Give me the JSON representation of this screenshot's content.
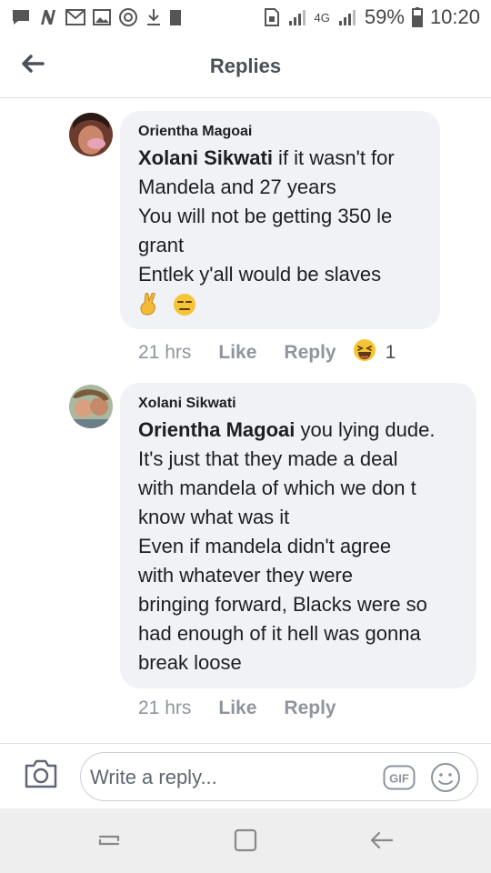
{
  "status_bar": {
    "left_icons": [
      "messenger-icon",
      "n-icon",
      "gmail-icon",
      "gallery-icon",
      "instagram-icon",
      "download-icon",
      "storage-icon"
    ],
    "network_label": "4G",
    "battery_percent": "59%",
    "time": "10:20"
  },
  "header": {
    "title": "Replies"
  },
  "comments": [
    {
      "author": "Orientha Magoai",
      "mention": "Xolani Sikwati",
      "first_line_rest": " if it wasn't for",
      "lines": [
        "Mandela and 27 years",
        "You will not be  getting 350 le",
        "grant",
        "Entlek y'all would be slaves"
      ],
      "emojis": [
        "crossed-fingers-emoji",
        "unamused-face-emoji"
      ],
      "time": "21 hrs",
      "like_label": "Like",
      "reply_label": "Reply",
      "reaction_icon": "haha-reaction-icon",
      "reaction_count": "1"
    },
    {
      "author": "Xolani Sikwati",
      "mention": "Orientha Magoai",
      "first_line_rest": " you lying  dude.",
      "lines": [
        "It's  just that they made a deal",
        "with mandela of which we don t",
        "know what was it",
        "Even if mandela didn't  agree",
        "with  whatever  they were",
        "bringing forward, Blacks were so",
        "had enough  of it hell was gonna",
        "break loose"
      ],
      "time": "21 hrs",
      "like_label": "Like",
      "reply_label": "Reply"
    }
  ],
  "composer": {
    "placeholder": "Write a reply...",
    "gif_label": "GIF"
  },
  "colors": {
    "bubble": "#f0f2f5",
    "meta_text": "#90949c",
    "navbar": "#eeeeee"
  }
}
